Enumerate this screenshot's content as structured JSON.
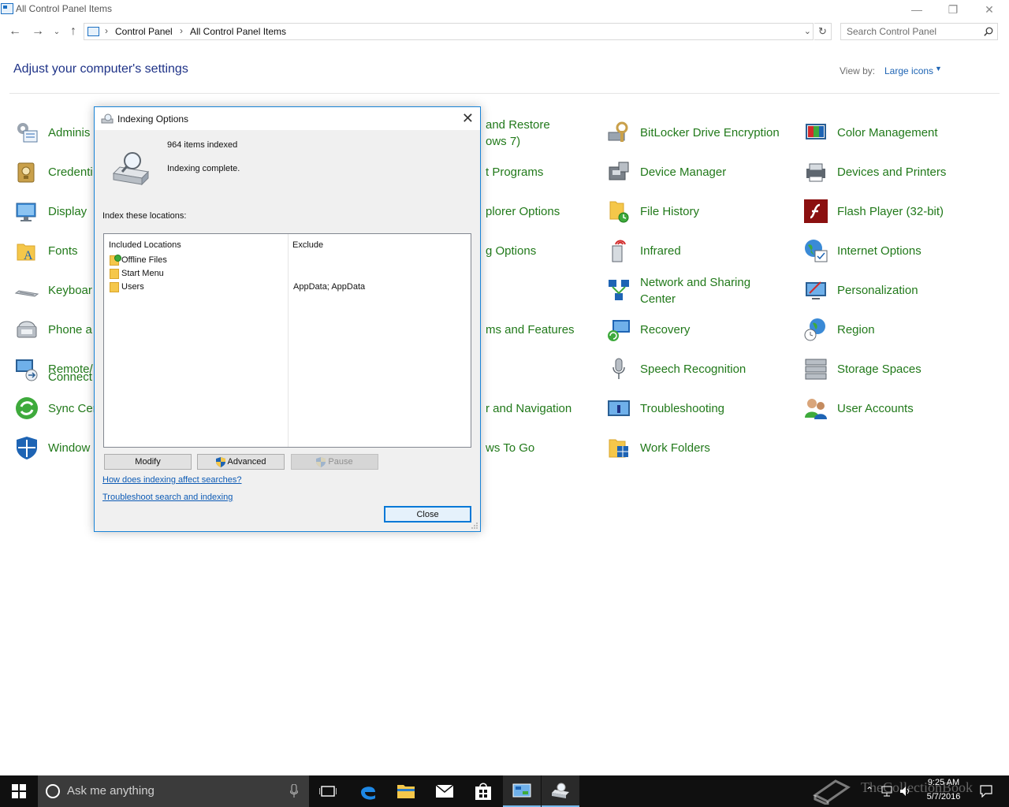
{
  "window": {
    "title": "All Control Panel Items",
    "minimize_glyph": "—",
    "restore_glyph": "❐",
    "close_glyph": "✕"
  },
  "address": {
    "crumbs": [
      "Control Panel",
      "All Control Panel Items"
    ],
    "search_placeholder": "Search Control Panel"
  },
  "header": {
    "title": "Adjust your computer's settings",
    "view_by_label": "View by:",
    "view_by_value": "Large icons"
  },
  "items": [
    {
      "label": "Adminis",
      "icon": "admin-tools-icon"
    },
    {
      "label": "Credenti",
      "icon": "credential-manager-icon"
    },
    {
      "label": "Display",
      "icon": "display-icon"
    },
    {
      "label": "Fonts",
      "icon": "fonts-icon"
    },
    {
      "label": "Keyboar",
      "icon": "keyboard-icon"
    },
    {
      "label": "Phone a",
      "icon": "phone-modem-icon"
    },
    {
      "label": "Remote/",
      "label2": "Connect",
      "icon": "remoteapp-icon"
    },
    {
      "label": "Sync Cer",
      "icon": "sync-center-icon"
    },
    {
      "label": "Window",
      "icon": "windows-defender-icon"
    },
    {
      "label": "and Restore",
      "label2": "ows 7)",
      "icon": "backup-restore-icon"
    },
    {
      "label": "t Programs",
      "icon": "default-programs-icon"
    },
    {
      "label": "plorer Options",
      "icon": "file-explorer-options-icon"
    },
    {
      "label": "g Options",
      "icon": "indexing-options-icon"
    },
    {
      "label": "ms and Features",
      "icon": "programs-features-icon"
    },
    {
      "label": "r and Navigation",
      "icon": "taskbar-navigation-icon"
    },
    {
      "label": "ws To Go",
      "icon": "windows-to-go-icon"
    },
    {
      "label": "BitLocker Drive Encryption",
      "icon": "bitlocker-icon"
    },
    {
      "label": "Device Manager",
      "icon": "device-manager-icon"
    },
    {
      "label": "File History",
      "icon": "file-history-icon"
    },
    {
      "label": "Infrared",
      "icon": "infrared-icon"
    },
    {
      "label": "Network and Sharing",
      "label2": "Center",
      "icon": "network-sharing-icon"
    },
    {
      "label": "Recovery",
      "icon": "recovery-icon"
    },
    {
      "label": "Speech Recognition",
      "icon": "speech-recognition-icon"
    },
    {
      "label": "Troubleshooting",
      "icon": "troubleshooting-icon"
    },
    {
      "label": "Work Folders",
      "icon": "work-folders-icon"
    },
    {
      "label": "Color Management",
      "icon": "color-management-icon"
    },
    {
      "label": "Devices and Printers",
      "icon": "devices-printers-icon"
    },
    {
      "label": "Flash Player (32-bit)",
      "icon": "flash-player-icon"
    },
    {
      "label": "Internet Options",
      "icon": "internet-options-icon"
    },
    {
      "label": "Personalization",
      "icon": "personalization-icon"
    },
    {
      "label": "Region",
      "icon": "region-icon"
    },
    {
      "label": "Storage Spaces",
      "icon": "storage-spaces-icon"
    },
    {
      "label": "User Accounts",
      "icon": "user-accounts-icon"
    }
  ],
  "dialog": {
    "title": "Indexing Options",
    "items_indexed": "964 items indexed",
    "status": "Indexing complete.",
    "index_label": "Index these locations:",
    "col_included": "Included Locations",
    "col_exclude": "Exclude",
    "locations": [
      {
        "name": "Offline Files",
        "exclude": ""
      },
      {
        "name": "Start Menu",
        "exclude": ""
      },
      {
        "name": "Users",
        "exclude": "AppData; AppData"
      }
    ],
    "modify_label": "Modify",
    "advanced_label": "Advanced",
    "pause_label": "Pause",
    "link_how": "How does indexing affect searches?",
    "link_troubleshoot": "Troubleshoot search and indexing",
    "close_label": "Close"
  },
  "taskbar": {
    "search_text": "Ask me anything",
    "time": "9:25 AM",
    "date": "5/7/2016",
    "watermark": "TheCollectionBook"
  },
  "colors": {
    "accent": "#0078d7",
    "link_green": "#21791a",
    "heading_blue": "#1e3287"
  }
}
